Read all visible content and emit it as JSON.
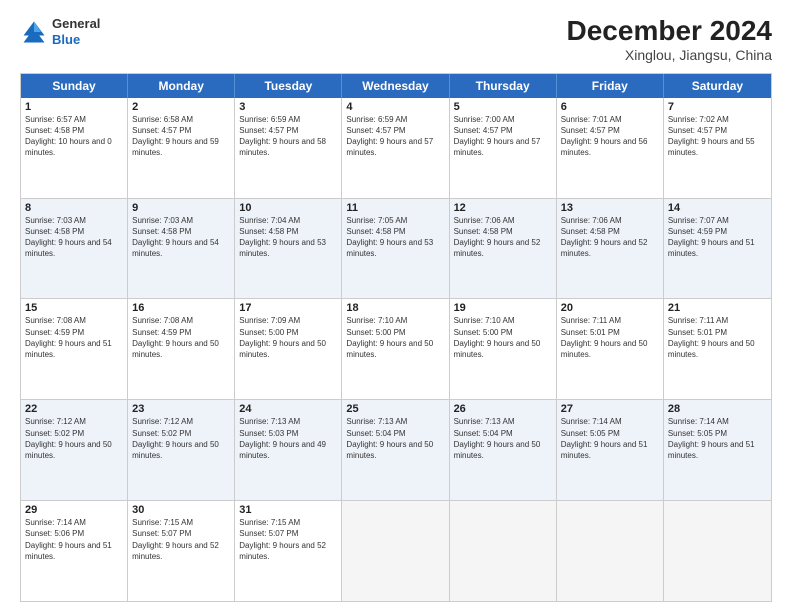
{
  "logo": {
    "general": "General",
    "blue": "Blue"
  },
  "title": "December 2024",
  "location": "Xinglou, Jiangsu, China",
  "days_of_week": [
    "Sunday",
    "Monday",
    "Tuesday",
    "Wednesday",
    "Thursday",
    "Friday",
    "Saturday"
  ],
  "weeks": [
    [
      {
        "day": 1,
        "rise": "6:57 AM",
        "set": "4:58 PM",
        "light": "10 hours and 0 minutes."
      },
      {
        "day": 2,
        "rise": "6:58 AM",
        "set": "4:57 PM",
        "light": "9 hours and 59 minutes."
      },
      {
        "day": 3,
        "rise": "6:59 AM",
        "set": "4:57 PM",
        "light": "9 hours and 58 minutes."
      },
      {
        "day": 4,
        "rise": "6:59 AM",
        "set": "4:57 PM",
        "light": "9 hours and 57 minutes."
      },
      {
        "day": 5,
        "rise": "7:00 AM",
        "set": "4:57 PM",
        "light": "9 hours and 57 minutes."
      },
      {
        "day": 6,
        "rise": "7:01 AM",
        "set": "4:57 PM",
        "light": "9 hours and 56 minutes."
      },
      {
        "day": 7,
        "rise": "7:02 AM",
        "set": "4:57 PM",
        "light": "9 hours and 55 minutes."
      }
    ],
    [
      {
        "day": 8,
        "rise": "7:03 AM",
        "set": "4:58 PM",
        "light": "9 hours and 54 minutes."
      },
      {
        "day": 9,
        "rise": "7:03 AM",
        "set": "4:58 PM",
        "light": "9 hours and 54 minutes."
      },
      {
        "day": 10,
        "rise": "7:04 AM",
        "set": "4:58 PM",
        "light": "9 hours and 53 minutes."
      },
      {
        "day": 11,
        "rise": "7:05 AM",
        "set": "4:58 PM",
        "light": "9 hours and 53 minutes."
      },
      {
        "day": 12,
        "rise": "7:06 AM",
        "set": "4:58 PM",
        "light": "9 hours and 52 minutes."
      },
      {
        "day": 13,
        "rise": "7:06 AM",
        "set": "4:58 PM",
        "light": "9 hours and 52 minutes."
      },
      {
        "day": 14,
        "rise": "7:07 AM",
        "set": "4:59 PM",
        "light": "9 hours and 51 minutes."
      }
    ],
    [
      {
        "day": 15,
        "rise": "7:08 AM",
        "set": "4:59 PM",
        "light": "9 hours and 51 minutes."
      },
      {
        "day": 16,
        "rise": "7:08 AM",
        "set": "4:59 PM",
        "light": "9 hours and 50 minutes."
      },
      {
        "day": 17,
        "rise": "7:09 AM",
        "set": "5:00 PM",
        "light": "9 hours and 50 minutes."
      },
      {
        "day": 18,
        "rise": "7:10 AM",
        "set": "5:00 PM",
        "light": "9 hours and 50 minutes."
      },
      {
        "day": 19,
        "rise": "7:10 AM",
        "set": "5:00 PM",
        "light": "9 hours and 50 minutes."
      },
      {
        "day": 20,
        "rise": "7:11 AM",
        "set": "5:01 PM",
        "light": "9 hours and 50 minutes."
      },
      {
        "day": 21,
        "rise": "7:11 AM",
        "set": "5:01 PM",
        "light": "9 hours and 50 minutes."
      }
    ],
    [
      {
        "day": 22,
        "rise": "7:12 AM",
        "set": "5:02 PM",
        "light": "9 hours and 50 minutes."
      },
      {
        "day": 23,
        "rise": "7:12 AM",
        "set": "5:02 PM",
        "light": "9 hours and 50 minutes."
      },
      {
        "day": 24,
        "rise": "7:13 AM",
        "set": "5:03 PM",
        "light": "9 hours and 49 minutes."
      },
      {
        "day": 25,
        "rise": "7:13 AM",
        "set": "5:04 PM",
        "light": "9 hours and 50 minutes."
      },
      {
        "day": 26,
        "rise": "7:13 AM",
        "set": "5:04 PM",
        "light": "9 hours and 50 minutes."
      },
      {
        "day": 27,
        "rise": "7:14 AM",
        "set": "5:05 PM",
        "light": "9 hours and 51 minutes."
      },
      {
        "day": 28,
        "rise": "7:14 AM",
        "set": "5:05 PM",
        "light": "9 hours and 51 minutes."
      }
    ],
    [
      {
        "day": 29,
        "rise": "7:14 AM",
        "set": "5:06 PM",
        "light": "9 hours and 51 minutes."
      },
      {
        "day": 30,
        "rise": "7:15 AM",
        "set": "5:07 PM",
        "light": "9 hours and 52 minutes."
      },
      {
        "day": 31,
        "rise": "7:15 AM",
        "set": "5:07 PM",
        "light": "9 hours and 52 minutes."
      },
      null,
      null,
      null,
      null
    ]
  ]
}
